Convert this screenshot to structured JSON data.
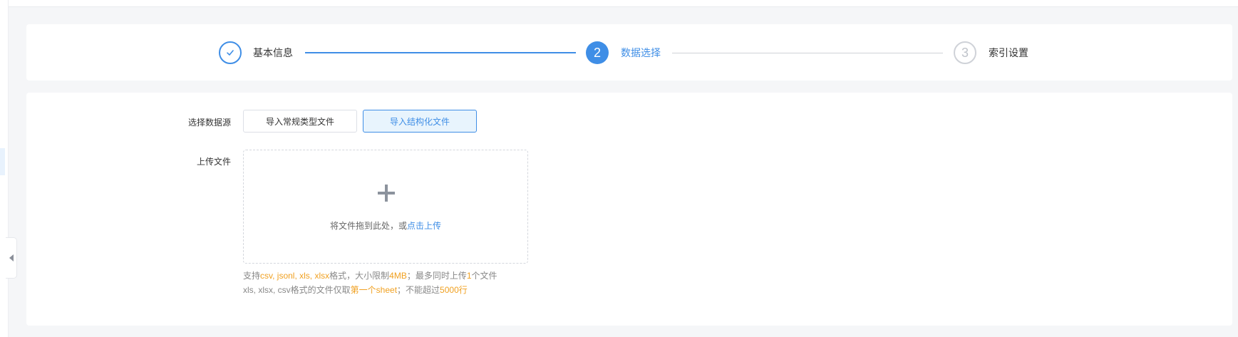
{
  "steps": [
    {
      "label": "基本信息",
      "status": "done"
    },
    {
      "label": "数据选择",
      "number": "2",
      "status": "active"
    },
    {
      "label": "索引设置",
      "number": "3",
      "status": "pending"
    }
  ],
  "form": {
    "source_label": "选择数据源",
    "source_options": [
      "导入常规类型文件",
      "导入结构化文件"
    ],
    "selected_source": "导入结构化文件",
    "upload_label": "上传文件",
    "upload_text": "将文件拖到此处，或",
    "upload_link": "点击上传"
  },
  "hints": {
    "line1": {
      "prefix": "支持",
      "formats": "csv, jsonl, xls, xlsx",
      "mid1": "格式，大小限制",
      "size": "4MB",
      "mid2": "；最多同时上传",
      "count": "1",
      "suffix": "个文件"
    },
    "line2": {
      "prefix": "xls, xlsx, csv格式的文件仅取",
      "sheet": "第一个sheet",
      "mid": "；不能超过",
      "rows": "5000行"
    }
  },
  "colors": {
    "accent": "#3f8ee6",
    "highlight": "#f0a020",
    "pending": "#cfd2d8"
  },
  "icons": [
    "check-icon",
    "plus-icon",
    "collapse-arrow-icon"
  ]
}
